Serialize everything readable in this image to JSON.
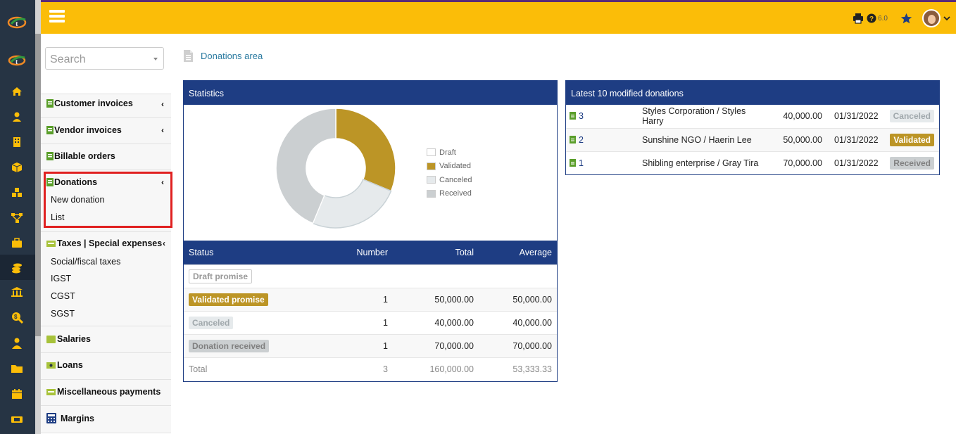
{
  "topbar": {
    "version": "6.0"
  },
  "menu": {
    "search_placeholder": "Search",
    "customer_invoices": "Customer invoices",
    "vendor_invoices": "Vendor invoices",
    "billable_orders": "Billable orders",
    "donations": "Donations",
    "new_donation": "New donation",
    "list": "List",
    "taxes": "Taxes | Special expenses",
    "social_taxes": "Social/fiscal taxes",
    "igst": "IGST",
    "cgst": "CGST",
    "sgst": "SGST",
    "salaries": "Salaries",
    "loans": "Loans",
    "misc_payments": "Miscellaneous payments",
    "margins": "Margins"
  },
  "breadcrumb": "Donations area",
  "stats": {
    "title": "Statistics",
    "legend": [
      "Draft",
      "Validated",
      "Canceled",
      "Received"
    ],
    "colors": {
      "draft": "#ffffff",
      "validated": "#bc9526",
      "canceled": "#e6eaec",
      "received": "#cbcfd1"
    },
    "headers": {
      "status": "Status",
      "number": "Number",
      "total": "Total",
      "average": "Average"
    },
    "rows": [
      {
        "status": "Draft promise",
        "number": "",
        "total": "",
        "average": ""
      },
      {
        "status": "Validated promise",
        "number": "1",
        "total": "50,000.00",
        "average": "50,000.00"
      },
      {
        "status": "Canceled",
        "number": "1",
        "total": "40,000.00",
        "average": "40,000.00"
      },
      {
        "status": "Donation received",
        "number": "1",
        "total": "70,000.00",
        "average": "70,000.00"
      }
    ],
    "total": {
      "label": "Total",
      "number": "3",
      "total": "160,000.00",
      "average": "53,333.33"
    }
  },
  "chart_data": {
    "type": "pie",
    "categories": [
      "Draft",
      "Validated",
      "Canceled",
      "Received"
    ],
    "values": [
      0,
      50000,
      40000,
      70000
    ],
    "title": "",
    "legend": "right"
  },
  "latest": {
    "title": "Latest 10 modified donations",
    "rows": [
      {
        "ref": "3",
        "name": "Styles Corporation / Styles Harry",
        "amount": "40,000.00",
        "date": "01/31/2022",
        "status": "Canceled"
      },
      {
        "ref": "2",
        "name": "Sunshine NGO / Haerin Lee",
        "amount": "50,000.00",
        "date": "01/31/2022",
        "status": "Validated"
      },
      {
        "ref": "1",
        "name": "Shibling enterprise / Gray Tira",
        "amount": "70,000.00",
        "date": "01/31/2022",
        "status": "Received"
      }
    ]
  }
}
